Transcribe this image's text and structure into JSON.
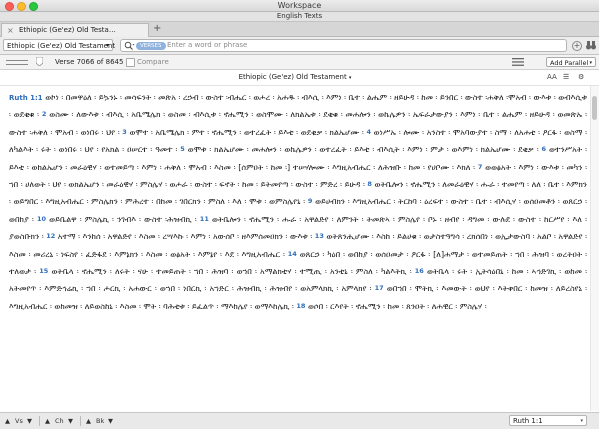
{
  "window": {
    "title": "Workspace",
    "subtitle": "English Texts"
  },
  "tab": {
    "label": "Ethiopic (Ge'ez) Old Testa…"
  },
  "search": {
    "resource": "Ethiopic (Ge'ez) Old Testament",
    "scope_pill": "VERSES",
    "placeholder": "Enter a word or phrase"
  },
  "toolbar": {
    "verse_position": "Verse 7066 of 8645",
    "compare_label": "Compare",
    "add_parallel_label": "Add Parallel"
  },
  "document": {
    "title": "Ethiopic (Ge'ez) Old Testament",
    "font_icon": "AA"
  },
  "text": [
    {
      "ref": "Ruth 1:1",
      "t": " ወኮነ ፡ በመዋዕለ ፡ ይኴንኑ ፡ መሳፍንት ፡ መጽአ ፡ ረኃብ ፡ ውስተ ፡ብሔር ፡ ወሖረ ፡ አሐዱ ፡ ብእሲ ፡ እምነ ፡ ቤተ ፡ ልሔም ፡ ዘይሁዳ ፡ ከመ ፡ ይንበር ፡ ውስተ ፡ሐቅለ ፡ሞአብ ፡ ውእቱ ፡ ወብእሲቱ ፡ ወደቂቁ ፡ "
    },
    {
      "vn": "2",
      "t": "ወስሙ ፡ ለውእቱ ፡ ብእሲ ፡ አቤሜሌክ ፡ ወስመ ፡ ብእሲቱ ፡ ኖሔሚን ፡ ወስሞሙ ፡ ለክልኤቱ ፡ ደቂቁ ፡ መሐሎን ፡ ወኬሌዎን ፡ ኤፍራታውያን ፡ እምነ ፡ ቤተ ፡ ልሔም ፡ ዘይሁዳ ፡ ወመጽኡ ፡ ውስተ ፡ሐቅለ ፡ ሞአብ ፡ ወነበሩ ፡ ህየ ፡ "
    },
    {
      "vn": "3",
      "t": "ወሞተ ፡ አቤሜሌክ ፡ ምተ ፡ ኖሔሚን ፡ ወተረፈት ፡ ይእቲ ፡ ወደቂቃ ፡ ክልኤሆሙ ፡ "
    },
    {
      "vn": "4",
      "t": "ወነሥኡ ፡ ሎሙ ፡ አንስተ ፡ ሞአባውያተ ፡ ስማ ፡ ለአሐቲ ፡ ዖርፋ ፡ ወስማ ፡ ለካልእት ፡ ሩት ፡ ወነበሩ ፡ ህየ ፡ የአክል ፡ ዐሠርተ ፡ ዓመተ ፡ "
    },
    {
      "vn": "5",
      "t": "ወሞቱ ፡ ክልኤሆሙ ፡ መሐሎን ፡ ወኬሌዎን ፡ ወተረፈት ፡ ይእቲ ፡ ብእሲት ፡ እምነ ፡ ምታ ፡ ወእምነ ፡ ክልኤሆሙ ፡ ደቂቃ ፡ "
    },
    {
      "vn": "6",
      "t": "ወተንሥአት ፡ ይእቲ ፡ ወከልኤሆን ፡ መራዕዊሃ ፡ ወተመይጣ ፡ እምነ ፡ ሐቅለ ፡ ሞአብ ፡ እስመ ፡ [ሰምዐት ፡ ከመ ፡] ተሠሃሎሙ ፡ እግዚአብሔር ፡ ለሕዝቡ ፡ ከመ ፡ የሀቦሙ ፡ እክለ ፡ "
    },
    {
      "vn": "7",
      "t": "ወወፅአት ፡ እምነ ፡ ውእቱ ፡ መካን ፡ ኀበ ፡ ሀለወት ፡ ህየ ፡ ወክልኤሆን ፡ መራዕዊሃ ፡ ምስሌሃ ፡ ወሖራ ፡ ውስተ ፡ ፍኖት ፡ ከመ ፡ ይትመየጣ ፡ ውስተ ፡ ምድረ ፡ ይሁዳ ፡ "
    },
    {
      "vn": "8",
      "t": "ወትቤሎን ፡ ኖሔሚን ፡ ለመራዕዊሃ ፡ ሑራ ፡ ተመየጣ ፡ ለለ ፡ ቤተ ፡ እምክን ፡ ወይግበር ፡ እግዚአብሔር ፡ ምስሌክን ፡ ምሕረተ ፡ በከመ ፡ ገበርክን ፡ ምስለ ፡ እለ ፡ ሞቱ ፡ ወምስሌየኒ ፡ "
    },
    {
      "vn": "9",
      "t": "ወይሀብክን ፡ እግዚአብሔር ፡ ትርከባ ፡ ዕረፍተ ፡ ውስተ ፡ ቤተ ፡ ብእሲሃ ፡ ወሰዐመቶን ፡ ወጸርኃ ፡ ወበከያ ፡ "
    },
    {
      "vn": "10",
      "t": "ወይቤልዋ ፡ ምስሌኪ ፡ ንገብእ ፡ ውስተ ፡ሕዝብኪ ፡ "
    },
    {
      "vn": "11",
      "t": "ወትቤሎን ፡ ኖሔሚን ፡ ሑራ ፡ አዋልድየ ፡ ለምንት ፡ ትመጽኣ ፡ ምስሌየ ፡ ቦኑ ፡ ዘብየ ፡ ዳግመ ፡ ውሉደ ፡ ውስተ ፡ ከርሥየ ፡ እለ ፡ ያወስቡክን ፡ "
    },
    {
      "vn": "12",
      "t": "አተማ ፡ እንከሰ ፡ አዋልድየ ፡ እስመ ፡ ረሣእኩ ፡ እምነ ፡ አውሰቦ ፡ ዘእምሰመዐክን ፡ ውእቱ ፡ "
    },
    {
      "vn": "13",
      "t": "ወትጸንሒሆሙ ፡ እስከ ፡ ይልሀቁ ፡ ወታስተዓግሳ ፡ ረክሰበነ ፡ ወኢታውስባ ፡ አልቦ ፡ አዋልድየ ፡ እስመ ፡ መሪረኒ ፡ ነፍስየ ፡ ፈድፋደ ፡ እምኔክን ፡ እስመ ፡ ወፅአት ፡ እምኔየ ፡ እደ ፡ እግዚአብሔር ፡ "
    },
    {
      "vn": "14",
      "t": "ወጸርኃ ፡ ካዕበ ፡ ወበከያ ፡ ወሰዐመታ ፡ ዖርፋ ፡ [ለ]ሐማታ ፡ ወተመይጠት ፡ ኀበ ፡ ሕዝባ ፡ ወረትዐት ፡ ተለወታ ፡ "
    },
    {
      "vn": "15",
      "t": "ወትቤላ ፡ ኖሔሚን ፡ ለሩት ፡ ናሁ ፡ ተመይጠት ፡ ኀበ ፡ ሕዝባ ፡ ወኀበ ፡ አማልክቲሃ ፡ ተሚጢ ፡ አንቲኒ ፡ ምስለ ፡ ካልእትኪ ፡ "
    },
    {
      "vn": "16",
      "t": "ወትቤላ ፡ ሩት ፡ ኢትሳዕበኒ ፡ ከመ ፡ ኣኅድገኪ ፡ ወከመ ፡ አትመየጥ ፡ እምድኅሬኪ ፡ ኀበ ፡ ሖርኪ ፡ አሐውር ፡ ወኀበ ፡ ነበርኪ ፡ አኀድር ፡ ሕዝብኪ ፡ ሕዝብየ ፡ ወአምላክኪ ፡ አምላክየ ፡ "
    },
    {
      "vn": "17",
      "t": "ወበኀበ ፡ ሞትኪ ፡ እመውት ፡ ወህየ ፡ እትቀበር ፡ ከመዝ ፡ ለይረስየኒ ፡ እግዚአብሔር ፡ ወከመዝ ፡ ለይወስከኒ ፡ እስመ ፡ ሞት ፡ ባሕቲቱ ፡ ይፈልጥ ፡ ማእከሌየ ፡ ወማእከሌኪ ፡ "
    },
    {
      "vn": "18",
      "t": "ወሶበ ፡ ርእየት ፡ ኖሔሚን ፡ ከመ ፡ ጸንዐት ፡ ለሐዊር ፡ ምስሌሃ ፡ "
    }
  ],
  "status": {
    "vs": "Vs",
    "ch": "Ch",
    "bk": "Bk",
    "reference": "Ruth 1:1"
  }
}
